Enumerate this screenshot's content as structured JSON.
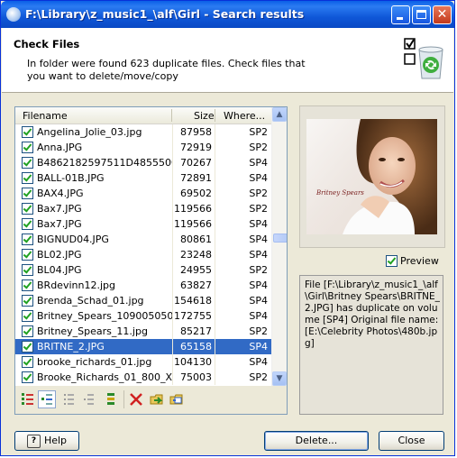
{
  "window": {
    "title": "F:\\Library\\z_music1_\\alf\\Girl - Search results"
  },
  "header": {
    "title": "Check Files",
    "description": "In folder were found 623 duplicate files. Check files that you want to delete/move/copy"
  },
  "list": {
    "columns": [
      "Filename",
      "Size",
      "Where..."
    ],
    "rows": [
      {
        "name": "Angelina_Jolie_03.jpg",
        "size": "87958",
        "where": "SP2",
        "checked": true
      },
      {
        "name": "Anna.JPG",
        "size": "72919",
        "where": "SP2",
        "checked": true
      },
      {
        "name": "B4862182597511D4855500...",
        "size": "70267",
        "where": "SP4",
        "checked": true
      },
      {
        "name": "BALL-01B.JPG",
        "size": "72891",
        "where": "SP4",
        "checked": true
      },
      {
        "name": "BAX4.JPG",
        "size": "69502",
        "where": "SP2",
        "checked": true
      },
      {
        "name": "Bax7.JPG",
        "size": "119566",
        "where": "SP2",
        "checked": true
      },
      {
        "name": "Bax7.JPG",
        "size": "119566",
        "where": "SP4",
        "checked": true
      },
      {
        "name": "BIGNUD04.JPG",
        "size": "80861",
        "where": "SP4",
        "checked": true
      },
      {
        "name": "BL02.JPG",
        "size": "23248",
        "where": "SP4",
        "checked": true
      },
      {
        "name": "BL04.JPG",
        "size": "24955",
        "where": "SP2",
        "checked": true
      },
      {
        "name": "BRdevinn12.jpg",
        "size": "63827",
        "where": "SP4",
        "checked": true
      },
      {
        "name": "Brenda_Schad_01.jpg",
        "size": "154618",
        "where": "SP4",
        "checked": true
      },
      {
        "name": "Britney_Spears_109005050...",
        "size": "172755",
        "where": "SP4",
        "checked": true
      },
      {
        "name": "Britney_Spears_11.jpg",
        "size": "85217",
        "where": "SP2",
        "checked": true
      },
      {
        "name": "BRITNE_2.JPG",
        "size": "65158",
        "where": "SP4",
        "checked": true,
        "selected": true
      },
      {
        "name": "brooke_richards_01.jpg",
        "size": "104130",
        "where": "SP4",
        "checked": true
      },
      {
        "name": "Brooke_Richards_01_800_X...",
        "size": "75003",
        "where": "SP2",
        "checked": true
      }
    ]
  },
  "preview": {
    "checkbox_label": "Preview",
    "photo_caption": "Britney Spears"
  },
  "info": {
    "text": "File [F:\\Library\\z_music1_\\alf\\Girl\\Britney Spears\\BRITNE_2.JPG] has duplicate on volume [SP4] Original file name: [E:\\Celebrity Photos\\480b.jpg]"
  },
  "buttons": {
    "help": "Help",
    "help_key": "?",
    "delete": "Delete...",
    "close": "Close"
  },
  "colors": {
    "accent": "#316ac5",
    "titlebar": "#0a5fe6",
    "check": "#21a121"
  }
}
